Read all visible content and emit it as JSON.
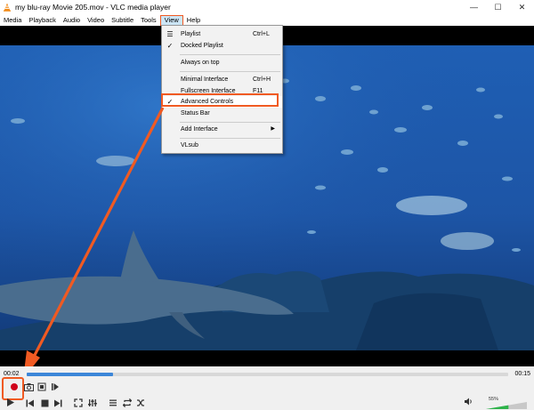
{
  "window": {
    "title": "my blu-ray Movie 205.mov - VLC media player",
    "minimize": "—",
    "maximize": "☐",
    "close": "✕"
  },
  "menubar": {
    "items": [
      {
        "label": "Media"
      },
      {
        "label": "Playback"
      },
      {
        "label": "Audio"
      },
      {
        "label": "Video"
      },
      {
        "label": "Subtitle"
      },
      {
        "label": "Tools"
      },
      {
        "label": "View"
      },
      {
        "label": "Help"
      }
    ],
    "active": "View"
  },
  "view_menu": {
    "items": [
      {
        "label": "Playlist",
        "shortcut": "Ctrl+L",
        "icon": "playlist-icon"
      },
      {
        "label": "Docked Playlist",
        "shortcut": "",
        "checked": true
      },
      {
        "label": "Always on top",
        "shortcut": ""
      },
      {
        "label": "Minimal Interface",
        "shortcut": "Ctrl+H"
      },
      {
        "label": "Fullscreen Interface",
        "shortcut": "F11"
      },
      {
        "label": "Advanced Controls",
        "shortcut": "",
        "checked": true,
        "highlighted": true
      },
      {
        "label": "Status Bar",
        "shortcut": ""
      },
      {
        "label": "Add Interface",
        "shortcut": "",
        "submenu": true
      },
      {
        "label": "VLsub",
        "shortcut": ""
      }
    ]
  },
  "player": {
    "elapsed": "00:02",
    "total": "00:15",
    "progress": 0.18,
    "volume": "55%",
    "volume_level": 0.55
  },
  "colors": {
    "accent": "#f05a22",
    "seek_fill": "#3c86d8",
    "volume_fill": "#2db34a",
    "record": "#d0021b"
  }
}
